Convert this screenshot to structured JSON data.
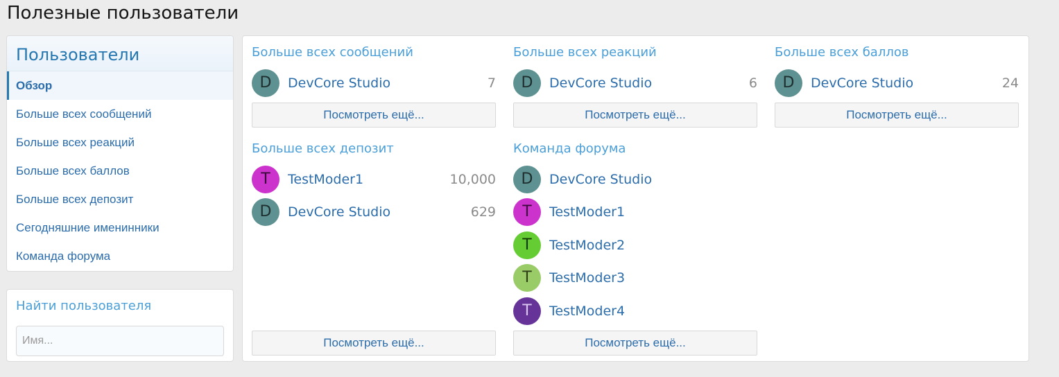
{
  "page": {
    "title": "Полезные пользователи"
  },
  "sidebar": {
    "header": "Пользователи",
    "items": [
      {
        "label": "Обзор"
      },
      {
        "label": "Больше всех сообщений"
      },
      {
        "label": "Больше всех реакций"
      },
      {
        "label": "Больше всех баллов"
      },
      {
        "label": "Больше всех депозит"
      },
      {
        "label": "Сегодняшние именинники"
      },
      {
        "label": "Команда форума"
      }
    ]
  },
  "find": {
    "title": "Найти пользователя",
    "placeholder": "Имя...",
    "value": ""
  },
  "colors": {
    "avatar_devcore": "#5e9191",
    "avatar_moder1": "#cc33cc",
    "avatar_moder2": "#66cc33",
    "avatar_moder3": "#99cc66",
    "avatar_moder4": "#663399"
  },
  "sections": {
    "messages": {
      "title": "Больше всех сообщений",
      "users": [
        {
          "initial": "D",
          "name": "DevCore Studio",
          "value": "7"
        }
      ],
      "more": "Посмотреть ещё..."
    },
    "reactions": {
      "title": "Больше всех реакций",
      "users": [
        {
          "initial": "D",
          "name": "DevCore Studio",
          "value": "6"
        }
      ],
      "more": "Посмотреть ещё..."
    },
    "points": {
      "title": "Больше всех баллов",
      "users": [
        {
          "initial": "D",
          "name": "DevCore Studio",
          "value": "24"
        }
      ],
      "more": "Посмотреть ещё..."
    },
    "deposit": {
      "title": "Больше всех депозит",
      "users": [
        {
          "initial": "T",
          "name": "TestModer1",
          "value": "10,000"
        },
        {
          "initial": "D",
          "name": "DevCore Studio",
          "value": "629"
        }
      ],
      "more": "Посмотреть ещё..."
    },
    "team": {
      "title": "Команда форума",
      "users": [
        {
          "initial": "D",
          "name": "DevCore Studio"
        },
        {
          "initial": "T",
          "name": "TestModer1"
        },
        {
          "initial": "T",
          "name": "TestModer2"
        },
        {
          "initial": "T",
          "name": "TestModer3"
        },
        {
          "initial": "T",
          "name": "TestModer4"
        }
      ],
      "more": "Посмотреть ещё..."
    }
  }
}
